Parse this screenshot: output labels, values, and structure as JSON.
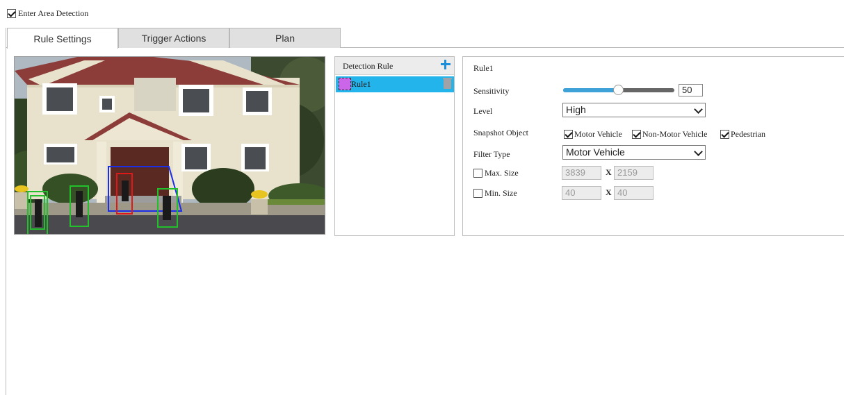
{
  "enable_checkbox": {
    "label": "Enter Area Detection",
    "checked": true
  },
  "tabs": [
    {
      "label": "Rule Settings",
      "active": true
    },
    {
      "label": "Trigger Actions",
      "active": false
    },
    {
      "label": "Plan",
      "active": false
    }
  ],
  "rule_list": {
    "header": "Detection Rule",
    "items": [
      {
        "label": "Rule1",
        "color": "#cc66e8",
        "selected": true
      }
    ]
  },
  "settings": {
    "rule_title": "Rule1",
    "sensitivity": {
      "label": "Sensitivity",
      "value": "50",
      "level": 0.5
    },
    "level": {
      "label": "Level",
      "value": "High"
    },
    "snapshot": {
      "label": "Snapshot Object",
      "options": [
        {
          "label": "Motor Vehicle",
          "checked": true
        },
        {
          "label": "Non-Motor Vehicle",
          "checked": true
        },
        {
          "label": "Pedestrian",
          "checked": true
        }
      ]
    },
    "filter_type": {
      "label": "Filter Type",
      "value": "Motor Vehicle"
    },
    "max_size": {
      "label": "Max. Size",
      "checked": false,
      "width": "3839",
      "height": "2159"
    },
    "min_size": {
      "label": "Min. Size",
      "checked": false,
      "width": "40",
      "height": "40"
    },
    "separator": "X"
  },
  "colors": {
    "accent": "#22b4ea",
    "plus": "#1a8ed8",
    "detect_green": "#22c02a",
    "detect_red": "#e01818",
    "area_blue": "#1a2de8"
  }
}
